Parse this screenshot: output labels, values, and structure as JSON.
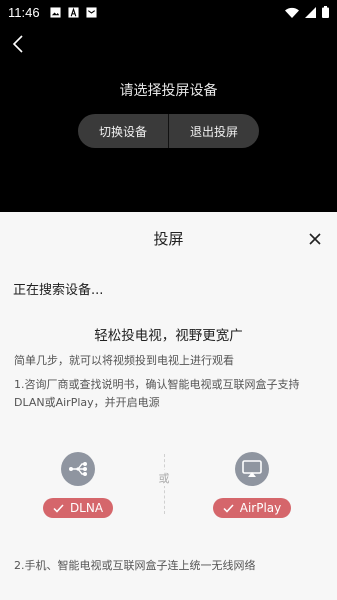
{
  "status_bar": {
    "time": "11:46",
    "left_icons": [
      "image-icon",
      "font-icon",
      "mail-icon"
    ],
    "right_icons": [
      "wifi-icon",
      "signal-icon",
      "battery-icon"
    ]
  },
  "header": {
    "back_icon": "chevron-left-icon"
  },
  "cast_panel": {
    "prompt": "请选择投屏设备",
    "switch_device_label": "切换设备",
    "exit_cast_label": "退出投屏"
  },
  "sheet": {
    "title": "投屏",
    "close_icon": "close-icon",
    "searching_text": "正在搜索设备...",
    "headline": "轻松投电视，视野更宽广",
    "description": "简单几步，就可以将视频投到电视上进行观看",
    "step1": "1.咨询厂商或查找说明书，确认智能电视或互联网盒子支持DLAN或AirPlay，并开启电源",
    "or_label": "或",
    "protocols": [
      {
        "name": "DLNA",
        "icon": "share-icon"
      },
      {
        "name": "AirPlay",
        "icon": "airplay-icon"
      }
    ],
    "step2": "2.手机、智能电视或互联网盒子连上统一无线网络"
  },
  "colors": {
    "badge": "#d5666b",
    "protocol_icon": "#8f95a0",
    "sheet_bg": "#f7f7f7"
  }
}
